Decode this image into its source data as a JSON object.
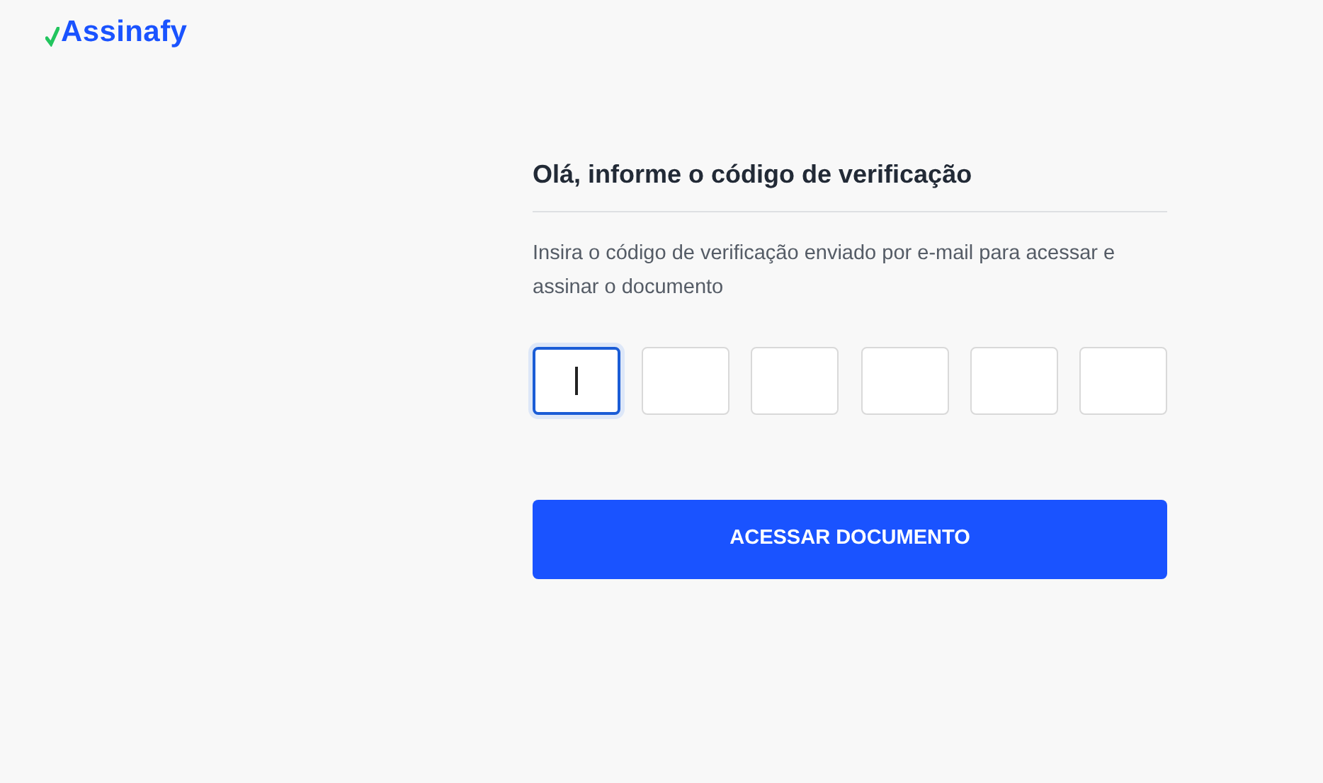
{
  "logo": {
    "text": "Assinafy"
  },
  "title": "Olá, informe o código de verificação",
  "instructions": "Insira o código de verificação enviado por e-mail para acessar e assinar o documento",
  "code_fields": [
    {
      "focused": true
    },
    {
      "focused": false
    },
    {
      "focused": false
    },
    {
      "focused": false
    },
    {
      "focused": false
    },
    {
      "focused": false
    }
  ],
  "submit_button": "ACESSAR DOCUMENTO"
}
